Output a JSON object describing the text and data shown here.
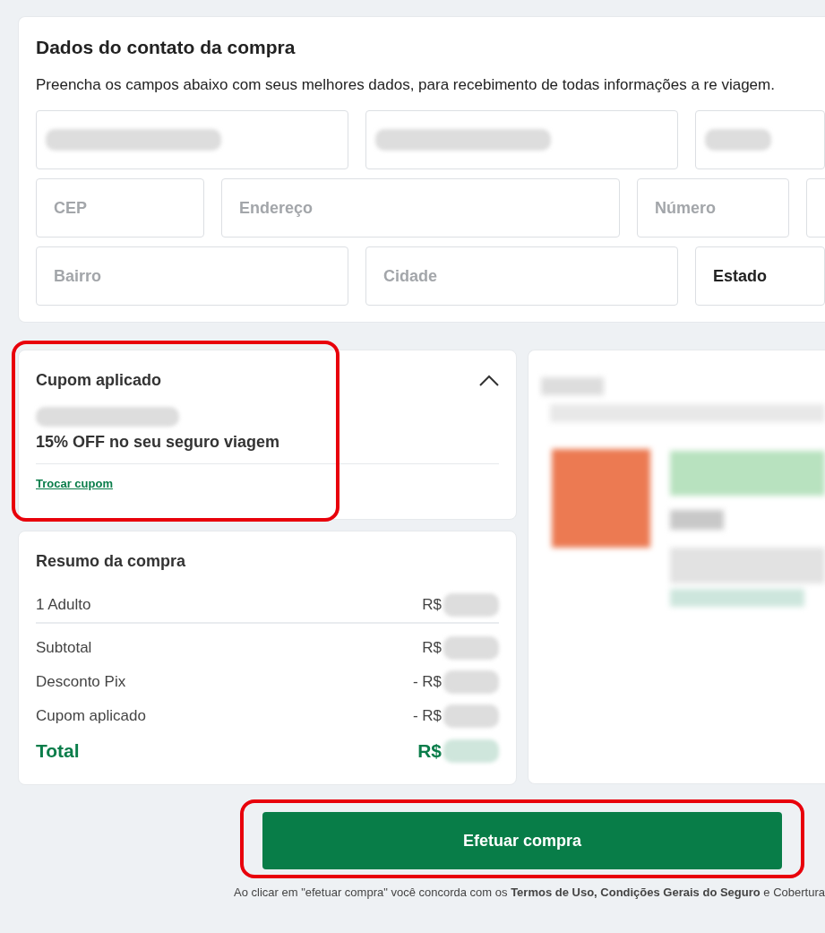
{
  "contact": {
    "title": "Dados do contato da compra",
    "description": "Preencha os campos abaixo com seus melhores dados, para recebimento de todas informações a re viagem.",
    "rows": [
      [
        {
          "kind": "redacted"
        },
        {
          "kind": "redacted"
        },
        {
          "kind": "redacted"
        }
      ],
      [
        {
          "kind": "input",
          "placeholder": "CEP"
        },
        {
          "kind": "input",
          "placeholder": "Endereço"
        },
        {
          "kind": "input",
          "placeholder": "Número"
        },
        {
          "kind": "input"
        }
      ],
      [
        {
          "kind": "input",
          "placeholder": "Bairro"
        },
        {
          "kind": "input",
          "placeholder": "Cidade"
        },
        {
          "kind": "select",
          "value": "Estado"
        }
      ]
    ]
  },
  "coupon": {
    "title": "Cupom aplicado",
    "expanded": true,
    "highlighted": true,
    "description": "15% OFF no seu seguro viagem",
    "link": "Trocar cupom"
  },
  "summary": {
    "title": "Resumo da compra",
    "rows": [
      {
        "label": "1 Adulto",
        "value": "R$",
        "kind": "item"
      },
      {
        "label": "Subtotal",
        "value": "R$",
        "kind": "line"
      },
      {
        "label": "Desconto Pix",
        "value": "- R$",
        "kind": "line"
      },
      {
        "label": "Cupom aplicado",
        "value": "- R$",
        "kind": "line"
      },
      {
        "label": "Total",
        "value": "R$",
        "kind": "total"
      }
    ]
  },
  "purchase_button": {
    "label": "Efetuar compra",
    "highlighted": true
  },
  "terms": "Ao clicar em \"efetuar compra\" você concorda com os **Termos de Uso, Condições Gerais do Seguro** e Cobertura"
}
